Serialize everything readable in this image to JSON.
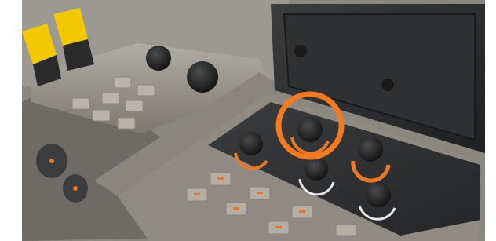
{
  "image": {
    "subject": "tractor-cab-control-console",
    "highlight": {
      "color": "#f47a20"
    },
    "palette": {
      "console": "#8f8b84",
      "console_light": "#a9a59e",
      "panel_dark": "#2f3133",
      "screen": "#2a2b2c",
      "lever_yellow": "#f2c800",
      "knob": "#1e1f20",
      "accent_orange": "#e8782a",
      "button": "#b4aea4"
    }
  }
}
